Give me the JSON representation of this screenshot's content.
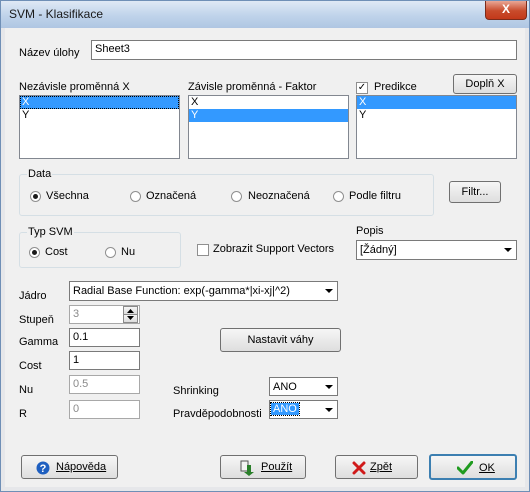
{
  "window": {
    "title": "SVM - Klasifikace",
    "close_glyph": "X"
  },
  "task": {
    "label": "Název úlohy",
    "value": "Sheet3"
  },
  "lists": {
    "independent": {
      "label": "Nezávisle proměnná X",
      "items": [
        "X",
        "Y"
      ],
      "selected": "X"
    },
    "dependent": {
      "label": "Závisle proměnná - Faktor",
      "items": [
        "X",
        "Y"
      ],
      "selected": "Y"
    },
    "prediction": {
      "label": "Predikce",
      "checked": true,
      "items": [
        "X",
        "Y"
      ],
      "selected": "X",
      "fill_button": "Doplň X"
    }
  },
  "data_group": {
    "title": "Data",
    "options": [
      "Všechna",
      "Označená",
      "Neoznačená",
      "Podle filtru"
    ],
    "selected": "Všechna",
    "filter_button": "Filtr..."
  },
  "svm_group": {
    "title": "Typ SVM",
    "options": [
      "Cost",
      "Nu"
    ],
    "selected": "Cost"
  },
  "support_vectors": {
    "label": "Zobrazit Support Vectors",
    "checked": false
  },
  "popis": {
    "label": "Popis",
    "value": "[Žádný]"
  },
  "params": {
    "kernel": {
      "label": "Jádro",
      "value": "Radial Base Function: exp(-gamma*|xi-xj|^2)"
    },
    "degree": {
      "label": "Stupeň",
      "value": "3"
    },
    "gamma": {
      "label": "Gamma",
      "value": "0.1"
    },
    "cost": {
      "label": "Cost",
      "value": "1"
    },
    "nu": {
      "label": "Nu",
      "value": "0.5"
    },
    "r": {
      "label": "R",
      "value": "0"
    },
    "weights_button": "Nastavit váhy",
    "shrinking": {
      "label": "Shrinking",
      "value": "ANO"
    },
    "probabilities": {
      "label": "Pravděpodobnosti",
      "value": "ANO"
    }
  },
  "footer": {
    "help": "Nápověda",
    "apply": "Použít",
    "back": "Zpět",
    "ok": "OK"
  },
  "icons": {
    "help": "help-question-icon",
    "apply": "apply-arrow-icon",
    "back": "back-cross-icon",
    "ok": "ok-check-icon"
  },
  "colors": {
    "selection": "#3399ff",
    "close_button": "#c84b2b",
    "ok_check": "#1f9b1f",
    "back_cross": "#d01a1a",
    "help_icon": "#1e5fc0"
  }
}
